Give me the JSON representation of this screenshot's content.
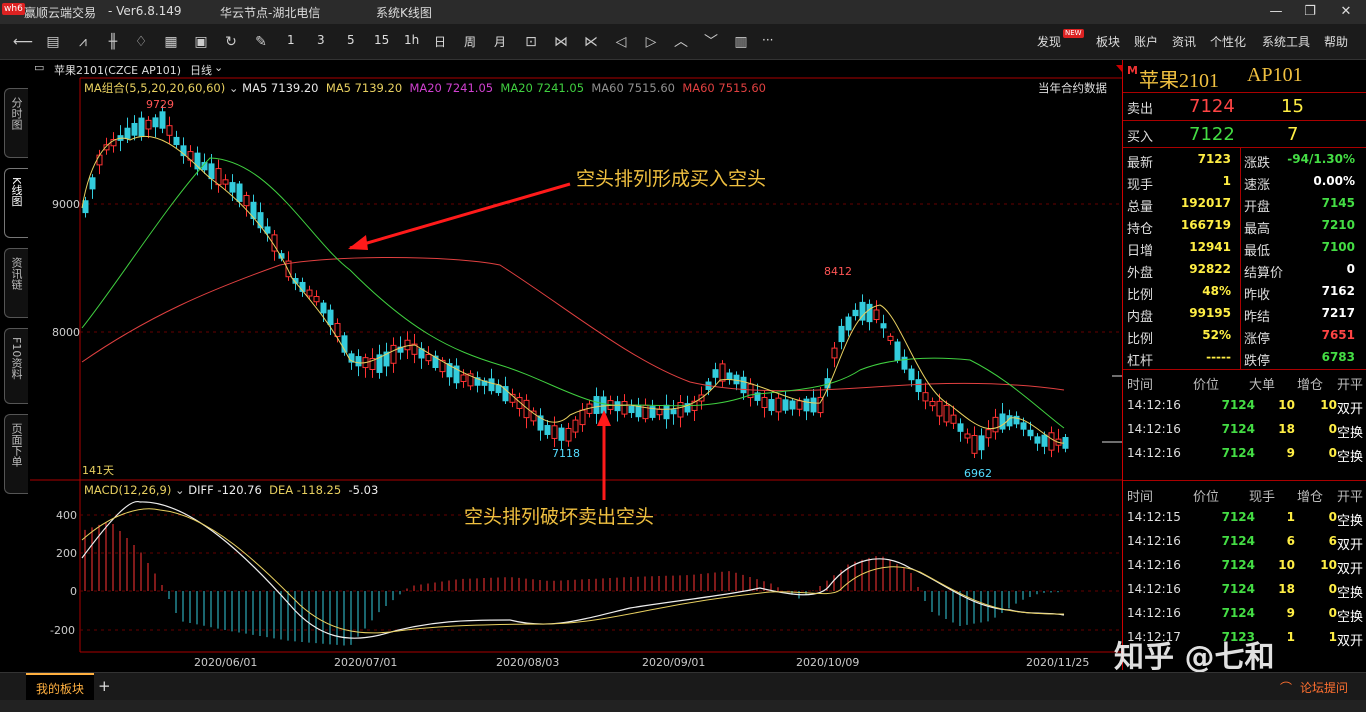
{
  "window": {
    "logo": "wh6",
    "app_name": "赢顺云端交易",
    "version": "- Ver6.8.149",
    "node": "华云节点-湖北电信",
    "menu": "系统K线图",
    "min_icon": "minimize-icon",
    "restore_icon": "restore-icon",
    "close_icon": "close-icon"
  },
  "toolbar": {
    "periods": [
      "1",
      "3",
      "5",
      "15",
      "1h",
      "日",
      "周",
      "月"
    ],
    "more": "···",
    "menus": [
      "发现",
      "板块",
      "账户",
      "资讯",
      "个性化",
      "系统工具",
      "帮助"
    ],
    "new_badge": "NEW"
  },
  "left_tabs": [
    "分时图",
    "K线图",
    "资讯链",
    "F10资料",
    "页面下单"
  ],
  "chart_header": {
    "symbol": "苹果2101(CZCE AP101)",
    "period": "日线",
    "right_label": "当年合约数据"
  },
  "ma_legend": {
    "group": "MA组合(5,5,20,20,60,60)",
    "items": [
      {
        "text": "MA5 7139.20",
        "color": "#e8e8e8"
      },
      {
        "text": "MA5 7139.20",
        "color": "#e8d060"
      },
      {
        "text": "MA20 7241.05",
        "color": "#d040d0"
      },
      {
        "text": "MA20 7241.05",
        "color": "#40d040"
      },
      {
        "text": "MA60 7515.60",
        "color": "#909090"
      },
      {
        "text": "MA60 7515.60",
        "color": "#e04040"
      }
    ]
  },
  "macd_legend": {
    "label": "MACD(12,26,9)",
    "diff": "DIFF -120.76",
    "dea": "DEA -118.25",
    "macd": "-5.03"
  },
  "annotations": {
    "top": "空头排列形成买入空头",
    "bottom": "空头排列破坏卖出空头"
  },
  "price_marks": {
    "high1": "9729",
    "low1": "7118",
    "high2": "8412",
    "low2": "6962",
    "days": "141天"
  },
  "chart_data": {
    "type": "candlestick",
    "y_axis_ticks": [
      9000,
      8000
    ],
    "macd_axis_ticks": [
      400,
      200,
      0,
      -200
    ],
    "x_axis_labels": [
      "2020/06/01",
      "2020/07/01",
      "2020/08/03",
      "2020/09/01",
      "2020/10/09",
      "2020/11/25"
    ],
    "colors": {
      "up": "#ff3333",
      "down": "#33ccdd"
    }
  },
  "quote": {
    "marker": "M",
    "name": "苹果2101",
    "code": "AP101",
    "ask_label": "卖出",
    "ask_price": "7124",
    "ask_vol": "15",
    "bid_label": "买入",
    "bid_price": "7122",
    "bid_vol": "7",
    "left_rows": [
      {
        "label": "最新",
        "value": "7123",
        "color": "#ffee44"
      },
      {
        "label": "现手",
        "value": "1",
        "color": "#ffee44"
      },
      {
        "label": "总量",
        "value": "192017",
        "color": "#ffee44"
      },
      {
        "label": "持仓",
        "value": "166719",
        "color": "#ffee44"
      },
      {
        "label": "日增",
        "value": "12941",
        "color": "#ffee44"
      },
      {
        "label": "外盘",
        "value": "92822",
        "color": "#ffee44"
      },
      {
        "label": "比例",
        "value": "48%",
        "color": "#ffee44"
      },
      {
        "label": "内盘",
        "value": "99195",
        "color": "#ffee44"
      },
      {
        "label": "比例",
        "value": "52%",
        "color": "#ffee44"
      },
      {
        "label": "杠杆",
        "value": "-----",
        "color": "#ffee44"
      }
    ],
    "right_rows": [
      {
        "label": "涨跌",
        "value": "-94/1.30%",
        "color": "#44dd44"
      },
      {
        "label": "速涨",
        "value": "0.00%",
        "color": "#ffffff"
      },
      {
        "label": "开盘",
        "value": "7145",
        "color": "#44dd44"
      },
      {
        "label": "最高",
        "value": "7210",
        "color": "#44dd44"
      },
      {
        "label": "最低",
        "value": "7100",
        "color": "#44dd44"
      },
      {
        "label": "结算价",
        "value": "0",
        "color": "#ffffff"
      },
      {
        "label": "昨收",
        "value": "7162",
        "color": "#ffffff"
      },
      {
        "label": "昨结",
        "value": "7217",
        "color": "#ffffff"
      },
      {
        "label": "涨停",
        "value": "7651",
        "color": "#ff4444"
      },
      {
        "label": "跌停",
        "value": "6783",
        "color": "#44dd44"
      }
    ],
    "trade_headers": [
      "时间",
      "价位",
      "大单",
      "增仓",
      "开平"
    ],
    "trades1": [
      {
        "time": "14:12:16",
        "price": "7124",
        "vol": "10",
        "oi": "10",
        "type": "双开"
      },
      {
        "time": "14:12:16",
        "price": "7124",
        "vol": "18",
        "oi": "0",
        "type": "空换"
      },
      {
        "time": "14:12:16",
        "price": "7124",
        "vol": "9",
        "oi": "0",
        "type": "空换"
      }
    ],
    "trade_headers2": [
      "时间",
      "价位",
      "现手",
      "增仓",
      "开平"
    ],
    "trades2": [
      {
        "time": "14:12:15",
        "price": "7124",
        "vol": "1",
        "oi": "0",
        "type": "空换"
      },
      {
        "time": "14:12:16",
        "price": "7124",
        "vol": "6",
        "oi": "6",
        "type": "双开"
      },
      {
        "time": "14:12:16",
        "price": "7124",
        "vol": "10",
        "oi": "10",
        "type": "双开"
      },
      {
        "time": "14:12:16",
        "price": "7124",
        "vol": "18",
        "oi": "0",
        "type": "空换"
      },
      {
        "time": "14:12:16",
        "price": "7124",
        "vol": "9",
        "oi": "0",
        "type": "空换"
      },
      {
        "time": "14:12:17",
        "price": "7123",
        "vol": "1",
        "oi": "1",
        "type": "双开"
      }
    ]
  },
  "watermark": "知乎 @七和",
  "bottom": {
    "my_board": "我的板块",
    "add": "+",
    "forum": "论坛提问"
  }
}
